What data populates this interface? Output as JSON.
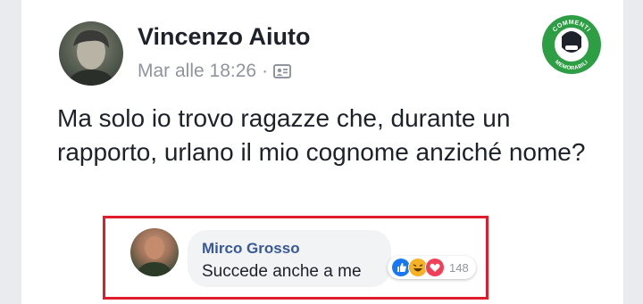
{
  "post": {
    "author": "Vincenzo Aiuto",
    "timestamp": "Mar alle 18:26",
    "separator": "·",
    "privacy_icon": "group-icon",
    "text": "Ma solo io trovo ragazze che, durante un rapporto, urlano il mio cognome anziché nome?"
  },
  "logo": {
    "top_text": "COMMENTI",
    "bottom_text": "MEMORABILI",
    "accent": "#2e9e44"
  },
  "comment": {
    "author": "Mirco Grosso",
    "text": "Succede anche a me",
    "reactions": [
      "like-icon",
      "haha-icon",
      "love-icon"
    ],
    "reaction_count": "148"
  },
  "colors": {
    "highlight_border": "#e01b2b",
    "name_blue": "#385898",
    "like_blue": "#1877f2",
    "love_red": "#f33e58",
    "haha_yellow": "#f7b125"
  }
}
